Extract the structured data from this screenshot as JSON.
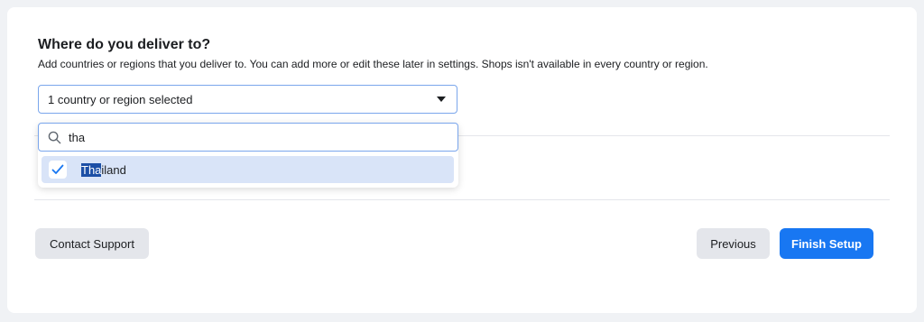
{
  "section": {
    "title": "Where do you deliver to?",
    "subtitle": "Add countries or regions that you deliver to. You can add more or edit these later in settings. Shops isn't available in every country or region."
  },
  "select": {
    "value": "1 country or region selected",
    "icon": "caret-down-icon"
  },
  "dropdown": {
    "search_value": "tha",
    "search_icon": "search-icon",
    "options": [
      {
        "highlight": "Tha",
        "rest": "iland",
        "label": "Thailand",
        "checked": true
      }
    ]
  },
  "footer": {
    "contact_label": "Contact Support",
    "previous_label": "Previous",
    "finish_label": "Finish Setup"
  },
  "colors": {
    "accent": "#1877f2",
    "selected_bg": "#d9e4f8",
    "highlight_bg": "#1c4fa6"
  }
}
